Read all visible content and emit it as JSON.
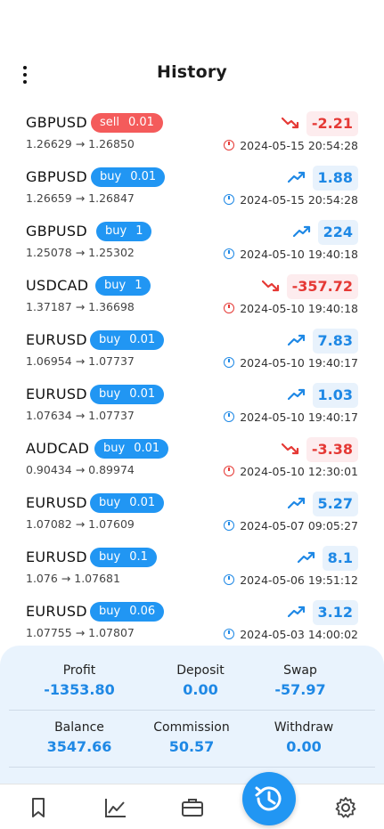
{
  "header": {
    "title": "History",
    "menu_icon": "more-vertical-icon"
  },
  "colors": {
    "accent": "#2196f3",
    "profit_positive": "#1e88e5",
    "profit_negative": "#e53935",
    "sell_pill": "#f45b5b"
  },
  "trades": [
    {
      "symbol": "GBPUSD",
      "side": "sell",
      "volume": "0.01",
      "open": "1.26629",
      "arrow": "→",
      "close": "1.26850",
      "profit": "-2.21",
      "time": "2024-05-15 20:54:28",
      "direction": "down"
    },
    {
      "symbol": "GBPUSD",
      "side": "buy",
      "volume": "0.01",
      "open": "1.26659",
      "arrow": "→",
      "close": "1.26847",
      "profit": "1.88",
      "time": "2024-05-15 20:54:28",
      "direction": "up"
    },
    {
      "symbol": "GBPUSD",
      "side": "buy",
      "volume": "1",
      "open": "1.25078",
      "arrow": "→",
      "close": "1.25302",
      "profit": "224",
      "time": "2024-05-10 19:40:18",
      "direction": "up"
    },
    {
      "symbol": "USDCAD",
      "side": "buy",
      "volume": "1",
      "open": "1.37187",
      "arrow": "→",
      "close": "1.36698",
      "profit": "-357.72",
      "time": "2024-05-10 19:40:18",
      "direction": "down"
    },
    {
      "symbol": "EURUSD",
      "side": "buy",
      "volume": "0.01",
      "open": "1.06954",
      "arrow": "→",
      "close": "1.07737",
      "profit": "7.83",
      "time": "2024-05-10 19:40:17",
      "direction": "up"
    },
    {
      "symbol": "EURUSD",
      "side": "buy",
      "volume": "0.01",
      "open": "1.07634",
      "arrow": "→",
      "close": "1.07737",
      "profit": "1.03",
      "time": "2024-05-10 19:40:17",
      "direction": "up"
    },
    {
      "symbol": "AUDCAD",
      "side": "buy",
      "volume": "0.01",
      "open": "0.90434",
      "arrow": "→",
      "close": "0.89974",
      "profit": "-3.38",
      "time": "2024-05-10 12:30:01",
      "direction": "down"
    },
    {
      "symbol": "EURUSD",
      "side": "buy",
      "volume": "0.01",
      "open": "1.07082",
      "arrow": "→",
      "close": "1.07609",
      "profit": "5.27",
      "time": "2024-05-07 09:05:27",
      "direction": "up"
    },
    {
      "symbol": "EURUSD",
      "side": "buy",
      "volume": "0.1",
      "open": "1.076",
      "arrow": "→",
      "close": "1.07681",
      "profit": "8.1",
      "time": "2024-05-06 19:51:12",
      "direction": "up"
    },
    {
      "symbol": "EURUSD",
      "side": "buy",
      "volume": "0.06",
      "open": "1.07755",
      "arrow": "→",
      "close": "1.07807",
      "profit": "3.12",
      "time": "2024-05-03 14:00:02",
      "direction": "up"
    }
  ],
  "summary": {
    "profit": {
      "label": "Profit",
      "value": "-1353.80"
    },
    "deposit": {
      "label": "Deposit",
      "value": "0.00"
    },
    "swap": {
      "label": "Swap",
      "value": "-57.97"
    },
    "balance": {
      "label": "Balance",
      "value": "3547.66"
    },
    "commission": {
      "label": "Commission",
      "value": "50.57"
    },
    "withdraw": {
      "label": "Withdraw",
      "value": "0.00"
    }
  },
  "nav": {
    "items": [
      "bookmark-icon",
      "chart-line-icon",
      "briefcase-icon",
      "history-icon",
      "settings-icon"
    ],
    "active": "history-icon"
  }
}
